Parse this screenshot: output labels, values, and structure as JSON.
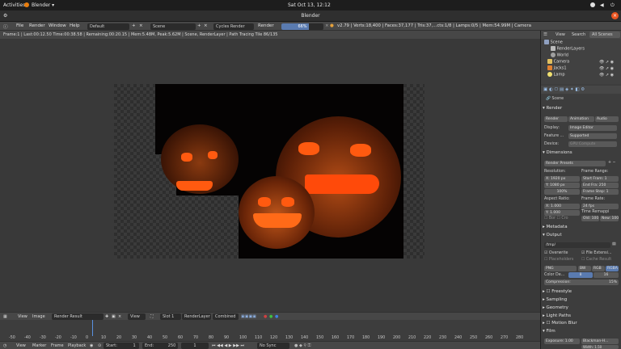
{
  "topbar": {
    "activities": "Activities",
    "app": "Blender ▾",
    "clock": "Sat Oct 13, 12:12"
  },
  "window": {
    "title": "Blender"
  },
  "menu": {
    "file": "File",
    "render": "Render",
    "window": "Window",
    "help": "Help",
    "layout": "Default",
    "scene": "Scene",
    "engine": "Cycles Render",
    "render_label": "Render",
    "progress_pct": 0.66,
    "progress_text": "66%",
    "stats": "v2.79 | Verts:18,400 | Faces:37,177 | Tris:37,...cts:1/8 | Lamps:0/5 | Mem:54.99M | Camera"
  },
  "info": {
    "text": "Frame:1 | Last:00:12.50 Time:00:38.58 | Remaining:00:20.15 | Mem:5.48M, Peak:5.62M | Scene, RenderLayer | Path Tracing Tile 86/135"
  },
  "image_editor": {
    "view": "View",
    "image": "Image",
    "image_name": "Render Result",
    "view2": "View",
    "slot": "Slot 1",
    "layer": "RenderLayer",
    "pass": "Combined"
  },
  "timeline": {
    "ticks": [
      "-50",
      "-40",
      "-30",
      "-20",
      "-10",
      "0",
      "10",
      "20",
      "30",
      "40",
      "50",
      "60",
      "70",
      "80",
      "90",
      "100",
      "110",
      "120",
      "130",
      "140",
      "150",
      "160",
      "170",
      "180",
      "190",
      "200",
      "210",
      "220",
      "230",
      "240",
      "250",
      "260",
      "270",
      "280"
    ],
    "view": "View",
    "marker": "Marker",
    "frame": "Frame",
    "playback": "Playback",
    "start_label": "Start:",
    "start": "1",
    "end_label": "End:",
    "end": "250",
    "current": "1",
    "sync": "No Sync"
  },
  "outliner": {
    "tabs": [
      "View",
      "Search",
      "All Scenes"
    ],
    "items": [
      "Scene",
      "RenderLayers",
      "World",
      "Camera",
      "Jacks1",
      "Lamp"
    ]
  },
  "properties": {
    "scene": "Scene",
    "render_title": "Render",
    "render_btn": "Render",
    "animation_btn": "Animation",
    "audio_btn": "Audio",
    "display_label": "Display:",
    "display_value": "Image Editor",
    "feature_label": "Feature ...",
    "feature_value": "Supported",
    "device_label": "Device:",
    "device_value": "GPU Compute",
    "dimensions": "Dimensions",
    "render_presets": "Render Presets",
    "resolution": "Resolution:",
    "res_x": "X:",
    "res_x_val": "1920 px",
    "res_y": "Y:",
    "res_y_val": "1080 px",
    "res_pct": "100%",
    "frame_range": "Frame Range:",
    "start_frame": "Start Fram: 1",
    "end_frame": "End Fra: 250",
    "frame_step": "Frame Step: 1",
    "aspect": "Aspect Ratio:",
    "asp_x": "X:",
    "asp_x_val": "1.000",
    "asp_y": "Y:",
    "asp_y_val": "1.000",
    "frame_rate": "Frame Rate:",
    "fps": "24 fps",
    "time_remap": "Time Remappi",
    "bor": "Bor",
    "crop": "Cro",
    "old": "Old: 100",
    "new": "New: 100",
    "metadata": "Metadata",
    "output": "Output",
    "output_path": "/tmp/",
    "overwrite": "Overwrite",
    "file_ext": "File Extensi...",
    "placeholders": "Placeholders",
    "cache_result": "Cache Result",
    "format": "PNG",
    "bw": "BW",
    "rgb": "RGB",
    "rgba": "RGBA",
    "color_depth": "Color De...",
    "depth_8": "8",
    "depth_16": "16",
    "compression": "Compression:",
    "compression_val": "15%",
    "freestyle": "Freestyle",
    "sampling": "Sampling",
    "geometry": "Geometry",
    "light_paths": "Light Paths",
    "motion_blur": "Motion Blur",
    "film": "Film",
    "exposure": "Exposure: 1.00",
    "filter": "Blackman-H...",
    "width": "Width:",
    "width_val": "1.50"
  }
}
